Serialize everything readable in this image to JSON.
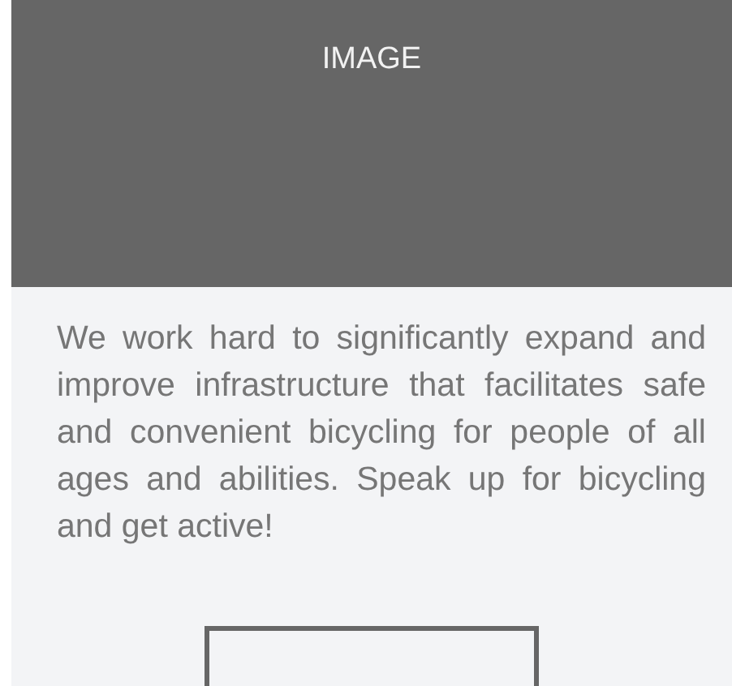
{
  "image_placeholder": {
    "label": "IMAGE"
  },
  "description": "We work hard to significantly expand and improve infrastructure that facilitates safe and convenient bicycling for people of all ages and abilities. Speak up for bicycling and get active!"
}
